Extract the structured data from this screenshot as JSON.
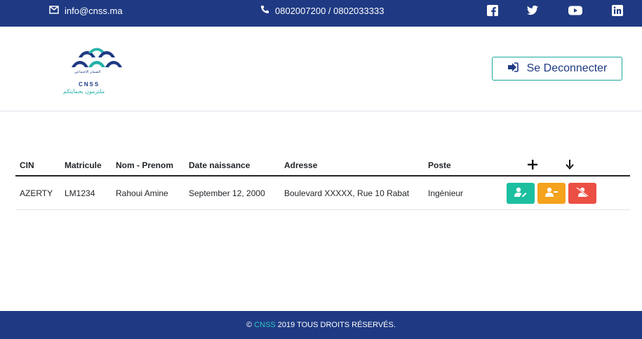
{
  "topbar": {
    "email": "info@cnss.ma",
    "phone": "0802007200 / 0802033333",
    "social": [
      "facebook-icon",
      "twitter-icon",
      "youtube-icon",
      "linkedin-icon"
    ]
  },
  "header": {
    "logo": {
      "text_arabic": "الضمان الاجتماعي",
      "text_cnss": "CNSS",
      "tagline": "ملتزمون بحمايتكم"
    },
    "logout_label": "Se Deconnecter"
  },
  "table": {
    "headers": [
      "CIN",
      "Matricule",
      "Nom - Prenom",
      "Date naissance",
      "Adresse",
      "Poste"
    ],
    "rows": [
      {
        "cin": "AZERTY",
        "matricule": "LM1234",
        "nom": "Rahoui Amine",
        "date": "September 12, 2000",
        "adresse": "Boulevard XXXXX, Rue 10 Rabat",
        "poste": "Ingénieur"
      }
    ]
  },
  "footer": {
    "prefix": "©",
    "brand": "CNSS",
    "suffix": "2019 TOUS DROITS RÉSERVÉS."
  },
  "colors": {
    "navy": "#1f3a83",
    "teal": "#1aa89c",
    "green": "#1cbfa0",
    "orange": "#f5a21c",
    "red": "#ec4f44"
  }
}
